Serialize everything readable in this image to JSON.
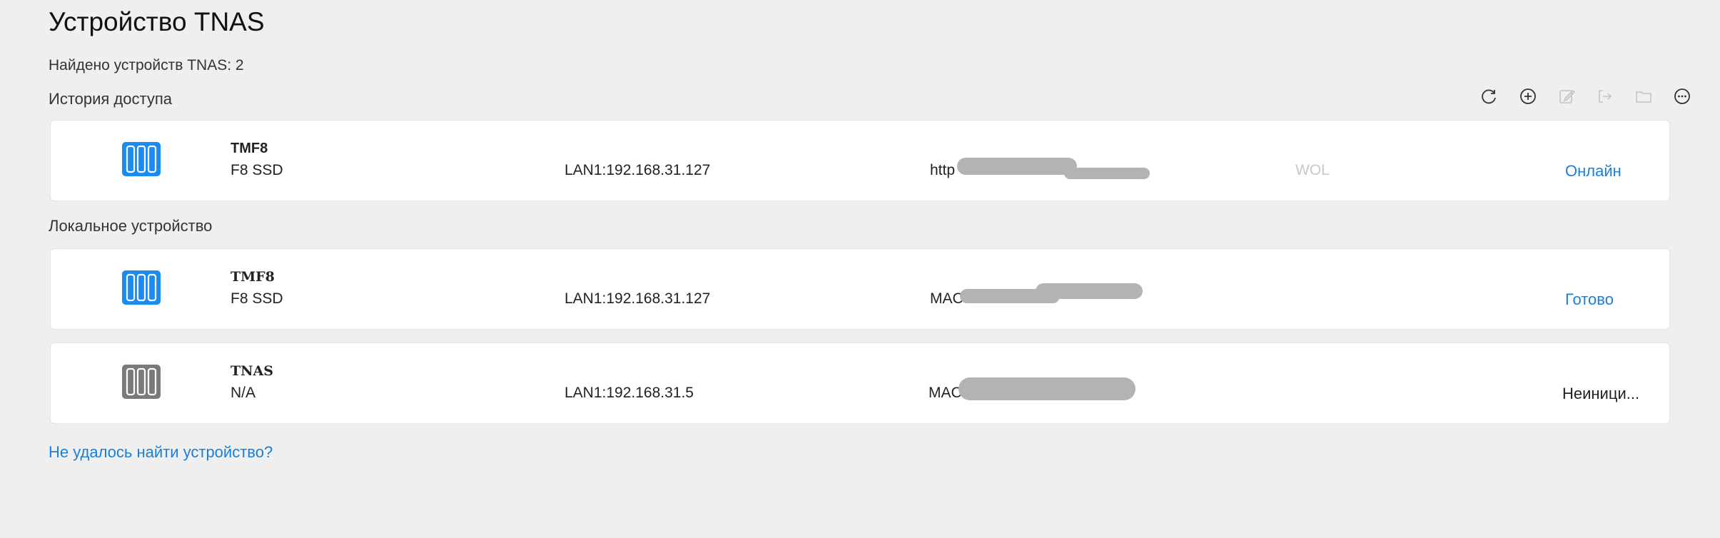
{
  "page": {
    "title": "Устройство TNAS",
    "found_text": "Найдено устройств TNAS: 2",
    "history_label": "История доступа",
    "local_label": "Локальное устройство",
    "help_link": "Не удалось найти устройство?"
  },
  "toolbar": {
    "icons": [
      "refresh-icon",
      "add-circle-icon",
      "edit-icon",
      "export-icon",
      "folder-icon",
      "more-icon"
    ]
  },
  "history_devices": [
    {
      "name": "TMF8",
      "model": "F8 SSD",
      "lan": "LAN1:192.168.31.127",
      "address_prefix": "http",
      "wol": "WOL",
      "status": "Онлайн",
      "icon_color": "#1a8bf0"
    }
  ],
  "local_devices": [
    {
      "name": "TMF8",
      "model": "F8 SSD",
      "lan": "LAN1:192.168.31.127",
      "address_prefix": "MAC",
      "status": "Готово",
      "icon_color": "#1a8bf0"
    },
    {
      "name": "TNAS",
      "model": "N/A",
      "lan": "LAN1:192.168.31.5",
      "address_prefix": "MAC:",
      "status": "Неиници...",
      "icon_color": "#7a7a7a"
    }
  ]
}
